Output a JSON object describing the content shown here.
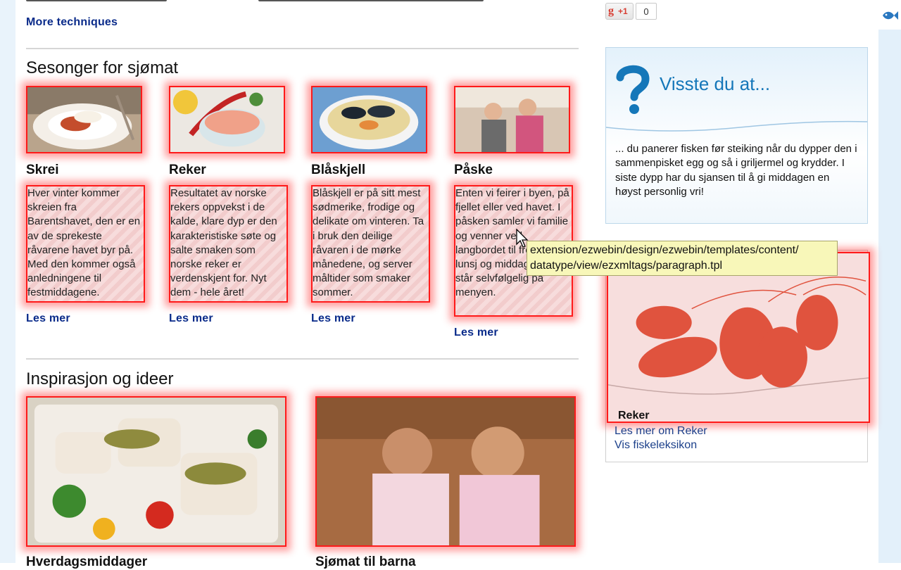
{
  "top": {
    "more_techniques": "More techniques",
    "gplus_label": "+1",
    "gplus_count": "0"
  },
  "seasons": {
    "heading": "Sesonger for sjømat",
    "items": [
      {
        "title": "Skrei",
        "text": "Hver vinter kommer skreien fra Barentshavet, den er en av de sprekeste råvarene havet byr på. Med den kommer også anledningene til festmiddagene.",
        "link": "Les mer"
      },
      {
        "title": "Reker",
        "text": "Resultatet av norske rekers oppvekst i de kalde, klare dyp er den karakteristiske søte og salte smaken som norske reker er verdenskjent for. Nyt dem - hele året!",
        "link": "Les mer"
      },
      {
        "title": "Blåskjell",
        "text": "Blåskjell er på sitt mest sødmerike, frodige og delikate om vinteren. Ta i bruk den deilige råvaren i de mørke månedene, og server måltider som smaker sommer.",
        "link": "Les mer"
      },
      {
        "title": "Påske",
        "text": "Enten vi feirer i byen, på fjellet eller ved havet. I påsken samler vi familie og venner ved langbordet til frokost, lunsj og middag. Sjømat står selvfølgelig på menyen.",
        "link": "Les mer"
      }
    ]
  },
  "inspiration": {
    "heading": "Inspirasjon og ideer",
    "items": [
      {
        "title": "Hverdagsmiddager"
      },
      {
        "title": "Sjømat til barna"
      }
    ]
  },
  "sidebar": {
    "visste_title": "Visste du at...",
    "visste_text": "... du panerer fisken før steiking når du dypper den i sammenpisket egg og så i griljermel og krydder. I siste dypp har du sjansen til å gi middagen en høyst personlig vri!",
    "feature_label": "Reker",
    "feature_link1": "Les mer om Reker",
    "feature_link2": "Vis fiskeleksikon"
  },
  "tooltip": {
    "line1": "extension/ezwebin/design/ezwebin/templates/content/",
    "line2": "datatype/view/ezxmltags/paragraph.tpl"
  },
  "colors": {
    "link": "#0a2b8a",
    "highlight": "#ff1a1a",
    "accent_blue": "#1577b9",
    "tooltip_bg": "#f8f7b9"
  }
}
